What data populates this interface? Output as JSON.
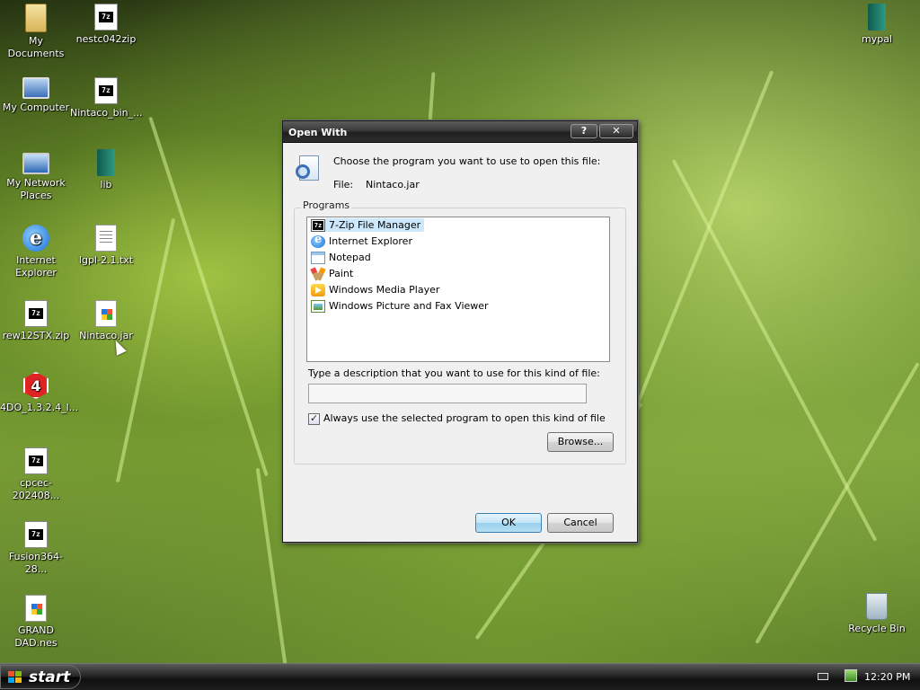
{
  "desktop": {
    "icons_left": [
      {
        "label": "My Documents",
        "icon": "folder-icon"
      },
      {
        "label": "nestc042zip",
        "icon": "7zip-archive-icon"
      },
      {
        "label": "My Computer",
        "icon": "computer-icon"
      },
      {
        "label": "Nintaco_bin_...",
        "icon": "7zip-archive-icon"
      },
      {
        "label": "My Network Places",
        "icon": "network-icon"
      },
      {
        "label": "lib",
        "icon": "book-icon"
      },
      {
        "label": "Internet Explorer",
        "icon": "internet-explorer-icon"
      },
      {
        "label": "lgpl-2.1.txt",
        "icon": "text-file-icon"
      },
      {
        "label": "rew12STX.zip",
        "icon": "7zip-archive-icon"
      },
      {
        "label": "Nintaco.jar",
        "icon": "jar-file-icon"
      },
      {
        "label": "4DO_1.3.2.4_l...",
        "icon": "4do-app-icon"
      },
      {
        "label": "cpcec-202408...",
        "icon": "7zip-archive-icon"
      },
      {
        "label": "Fusion364-28...",
        "icon": "7zip-archive-icon"
      },
      {
        "label": "GRAND DAD.nes",
        "icon": "nes-file-icon"
      }
    ],
    "icons_right": [
      {
        "label": "mypal",
        "icon": "book-icon"
      },
      {
        "label": "Recycle Bin",
        "icon": "recycle-bin-icon"
      }
    ]
  },
  "dialog": {
    "title": "Open With",
    "help_button": "?",
    "close_button": "✕",
    "instruction": "Choose the program you want to use to open this file:",
    "file_label": "File:",
    "file_name": "Nintaco.jar",
    "programs_label": "Programs",
    "programs": [
      {
        "name": "7-Zip File Manager",
        "icon": "7zip-icon",
        "selected": true
      },
      {
        "name": "Internet Explorer",
        "icon": "internet-explorer-icon",
        "selected": false
      },
      {
        "name": "Notepad",
        "icon": "notepad-icon",
        "selected": false
      },
      {
        "name": "Paint",
        "icon": "paint-icon",
        "selected": false
      },
      {
        "name": "Windows Media Player",
        "icon": "media-player-icon",
        "selected": false
      },
      {
        "name": "Windows Picture and Fax Viewer",
        "icon": "picture-viewer-icon",
        "selected": false
      }
    ],
    "description_label": "Type a description that you want to use for this kind of file:",
    "description_value": "",
    "always_use_label": "Always use the selected program to open this kind of file",
    "always_use_checked": true,
    "browse_label": "Browse...",
    "ok_label": "OK",
    "cancel_label": "Cancel"
  },
  "taskbar": {
    "start_label": "start",
    "clock": "12:20 PM"
  }
}
